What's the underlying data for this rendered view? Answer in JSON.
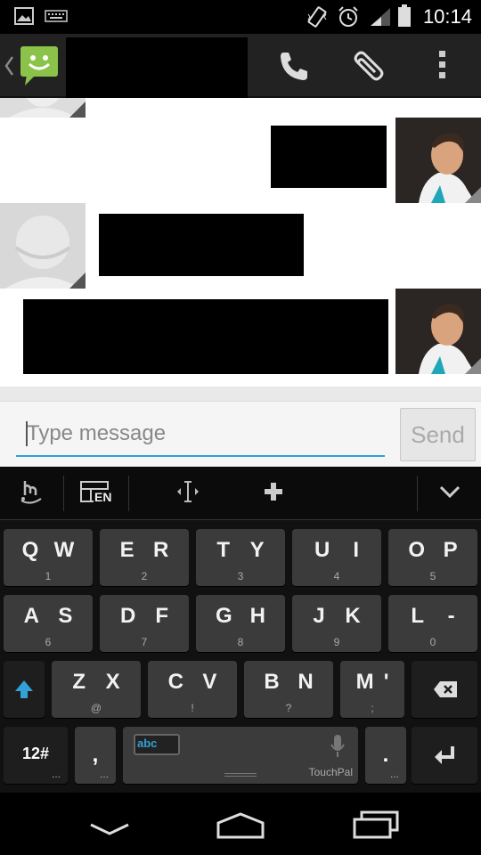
{
  "status_bar": {
    "time": "10:14",
    "icons": [
      "image-icon",
      "keyboard-icon",
      "vibrate-icon",
      "alarm-icon",
      "signal-icon",
      "battery-icon"
    ]
  },
  "action_bar": {
    "back_icon": "back-chevron-icon",
    "app_icon": "messaging-app-icon",
    "actions": [
      {
        "name": "call",
        "icon": "phone-icon"
      },
      {
        "name": "attach",
        "icon": "paperclip-icon"
      },
      {
        "name": "overflow",
        "icon": "overflow-menu-icon"
      }
    ]
  },
  "compose": {
    "placeholder": "Type message",
    "value": "",
    "send_label": "Send"
  },
  "keyboard_toolbar": {
    "icons": [
      "handwriting-icon",
      "layout-en-icon",
      "cursor-move-icon",
      "add-icon",
      "hide-keyboard-icon"
    ],
    "layout_label": "EN"
  },
  "keyboard": {
    "rows": [
      [
        {
          "main": [
            "Q",
            "W"
          ],
          "sub": "1"
        },
        {
          "main": [
            "E",
            "R"
          ],
          "sub": "2"
        },
        {
          "main": [
            "T",
            "Y"
          ],
          "sub": "3"
        },
        {
          "main": [
            "U",
            "I"
          ],
          "sub": "4"
        },
        {
          "main": [
            "O",
            "P"
          ],
          "sub": "5"
        }
      ],
      [
        {
          "main": [
            "A",
            "S"
          ],
          "sub": "6"
        },
        {
          "main": [
            "D",
            "F"
          ],
          "sub": "7"
        },
        {
          "main": [
            "G",
            "H"
          ],
          "sub": "8"
        },
        {
          "main": [
            "J",
            "K"
          ],
          "sub": "9"
        },
        {
          "main": [
            "L",
            "-"
          ],
          "sub": "0"
        }
      ],
      [
        {
          "main": [
            "Z",
            "X"
          ],
          "sub": "@"
        },
        {
          "main": [
            "C",
            "V"
          ],
          "sub": "!"
        },
        {
          "main": [
            "B",
            "N"
          ],
          "sub": "?"
        },
        {
          "main": [
            "M",
            "'"
          ],
          "sub": ";"
        }
      ]
    ],
    "symbols_label": "12#",
    "comma_label": ",",
    "period_label": ".",
    "space_lang_label": "abc",
    "space_brand": "TouchPal",
    "more_dots": "...",
    "accent": "#33a0d6"
  },
  "nav_bar": {
    "icons": [
      "back-nav-icon",
      "home-nav-icon",
      "recents-nav-icon"
    ]
  }
}
